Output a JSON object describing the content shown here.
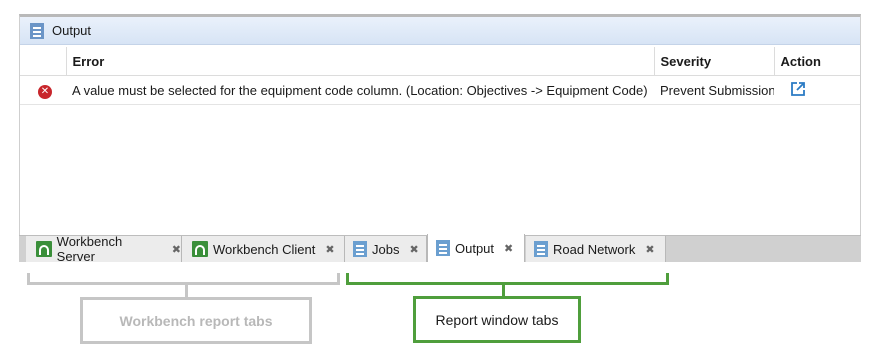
{
  "output_panel": {
    "title": "Output",
    "columns": {
      "error": "Error",
      "severity": "Severity",
      "action": "Action"
    },
    "rows": [
      {
        "status_icon": "error-icon",
        "error": "A value must be selected for the equipment code column. (Location: Objectives -> Equipment Code)",
        "severity": "Prevent Submission",
        "action_icon": "open-external-icon"
      }
    ]
  },
  "tabs": [
    {
      "label": "Workbench Server",
      "icon": "workbench-icon"
    },
    {
      "label": "Workbench Client",
      "icon": "workbench-icon"
    },
    {
      "label": "Jobs",
      "icon": "document-icon"
    },
    {
      "label": "Output",
      "icon": "document-icon",
      "active": true
    },
    {
      "label": "Road Network",
      "icon": "document-icon"
    }
  ],
  "annotations": {
    "workbench_tabs": "Workbench  report tabs",
    "report_tabs": "Report  window tabs"
  },
  "colors": {
    "accent_green": "#4f9e3c",
    "annotation_grey": "#c6c6c6",
    "error_red": "#c8262c"
  }
}
